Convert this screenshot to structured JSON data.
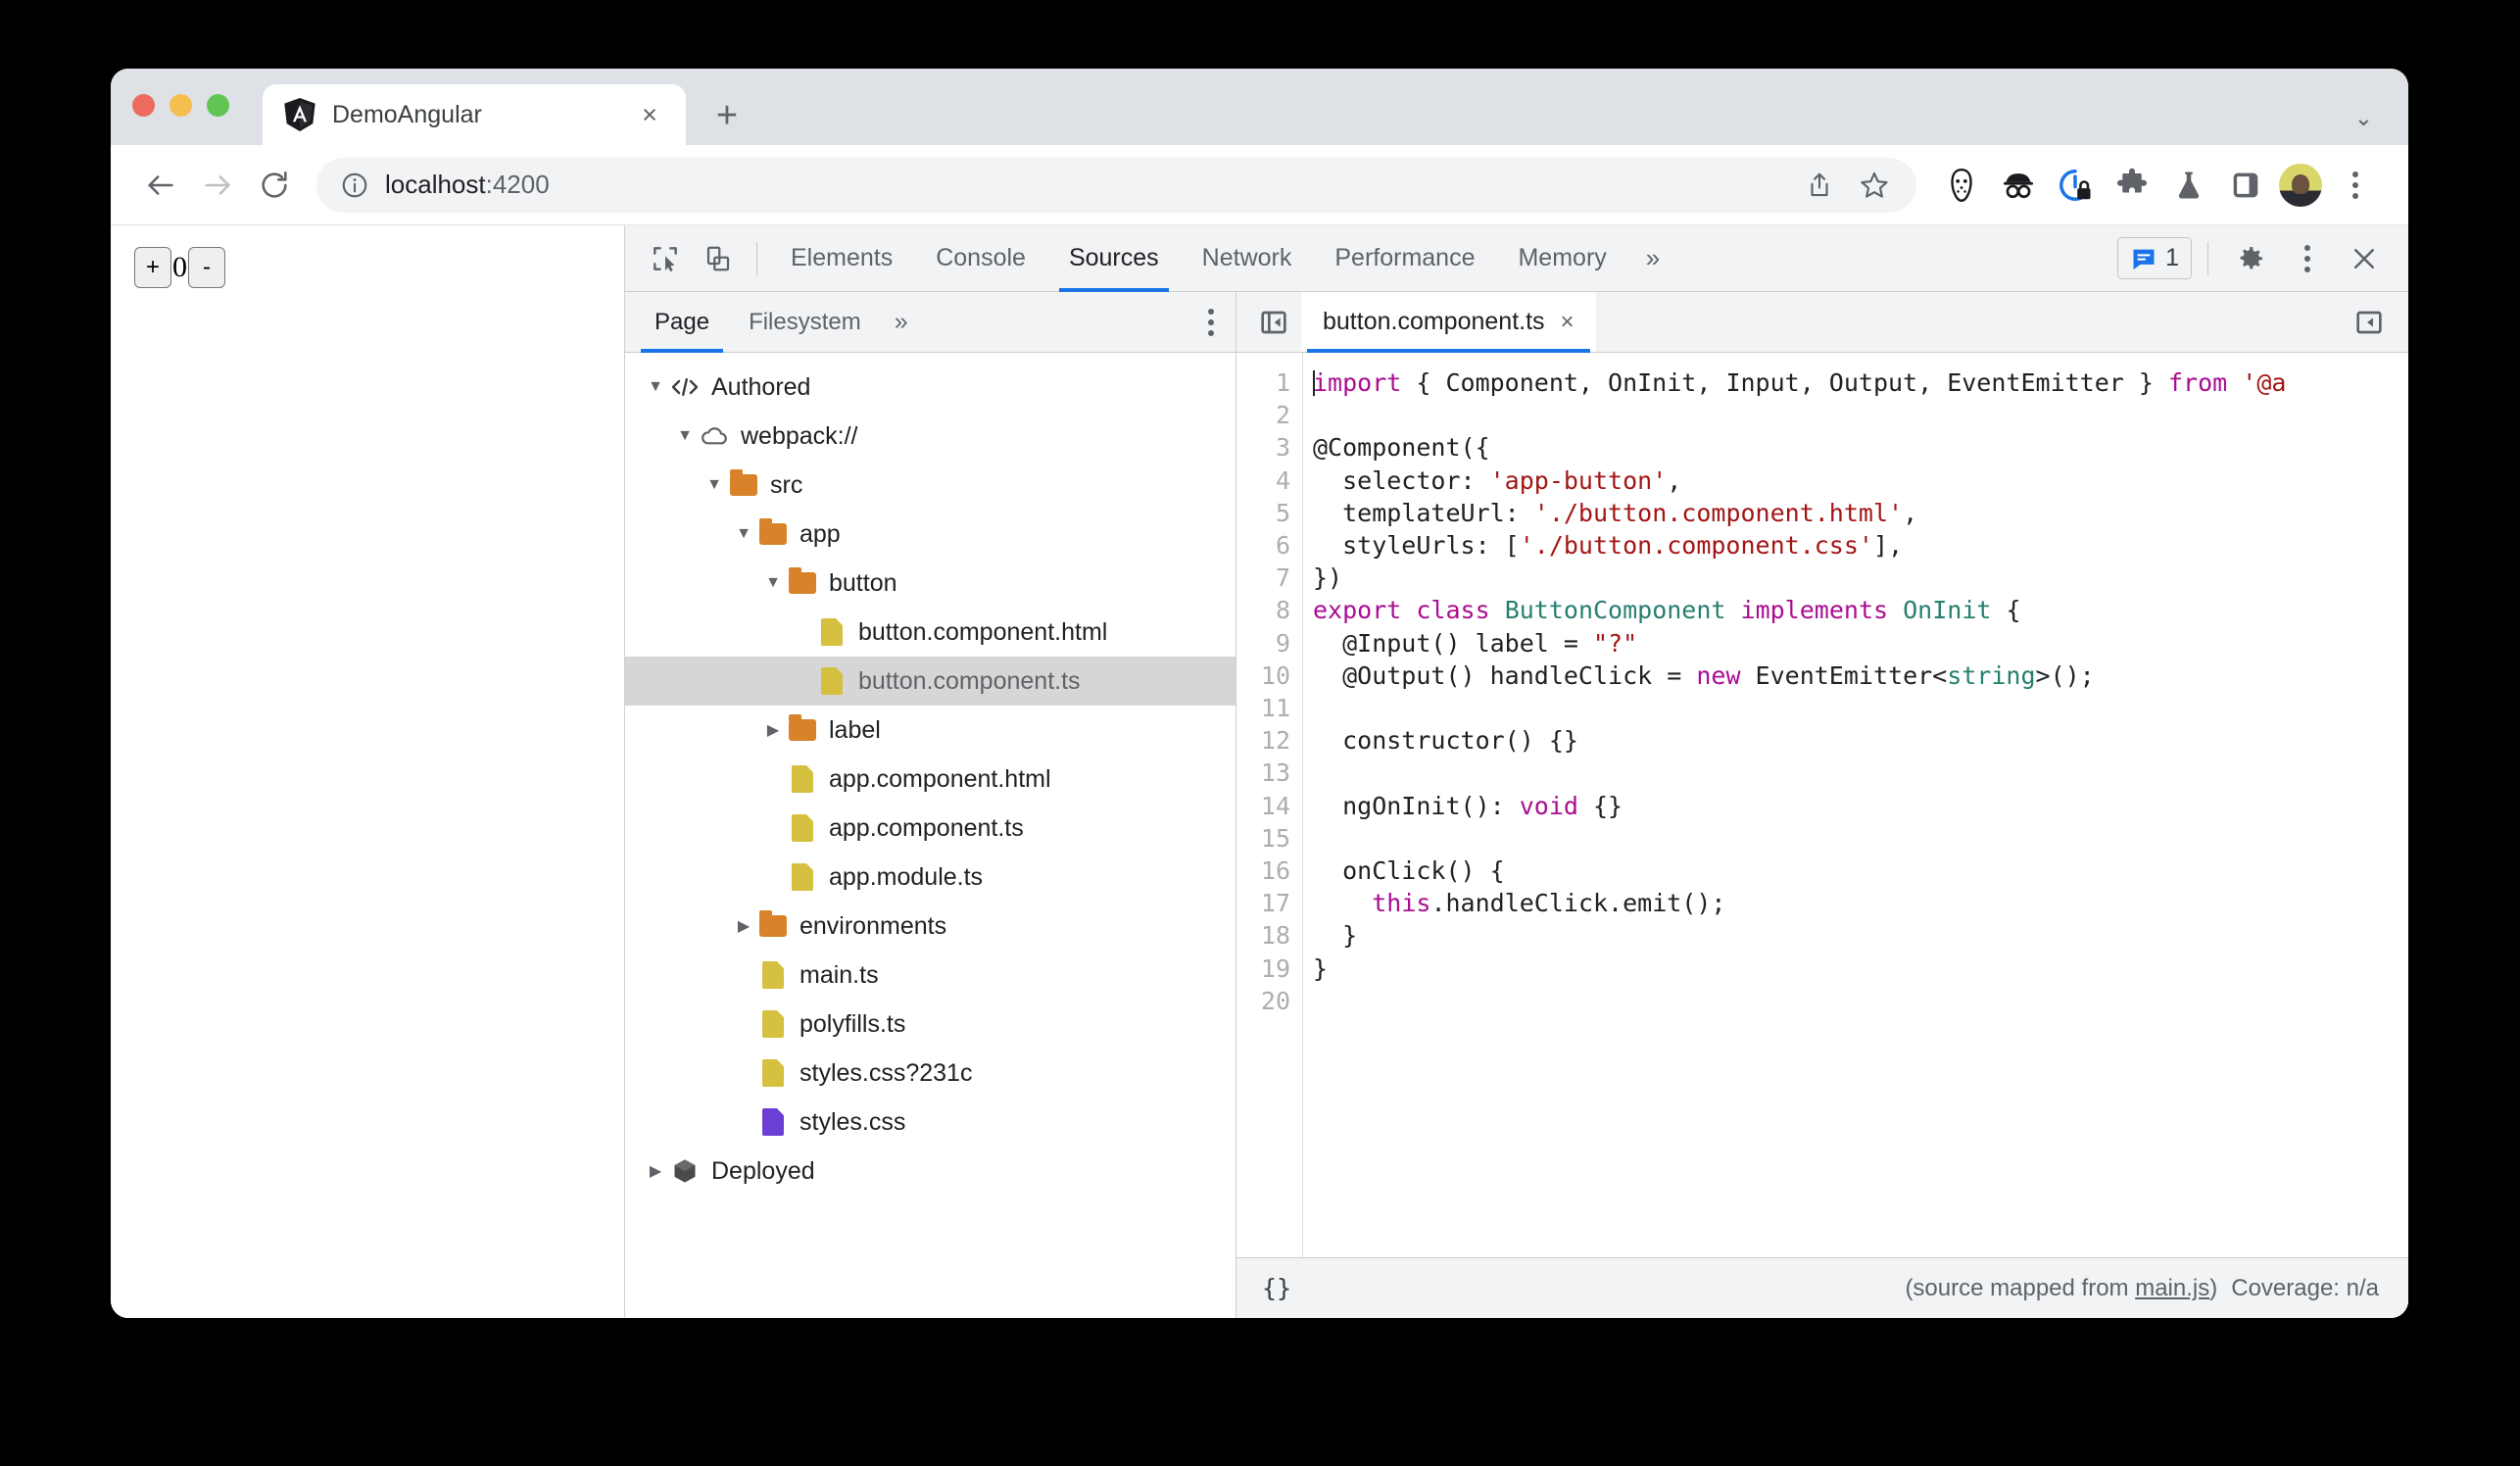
{
  "browser": {
    "tab": {
      "title": "DemoAngular",
      "favicon": "angular-logo-icon",
      "close": "×"
    },
    "new_tab": "+",
    "tabstrip_menu": "⌄",
    "nav": {
      "back": "←",
      "forward": "→",
      "reload": "⟳"
    },
    "omnibox": {
      "info_icon": "site-info-icon",
      "url_host": "localhost",
      "url_port": ":4200",
      "share_icon": "share-icon",
      "bookmark_icon": "star-icon"
    },
    "extensions": [
      {
        "name": "hockey-mask-extension-icon"
      },
      {
        "name": "incognito-og-extension-icon"
      },
      {
        "name": "privacy-lock-extension-icon"
      },
      {
        "name": "puzzle-extensions-icon"
      },
      {
        "name": "flask-experiments-icon"
      },
      {
        "name": "side-panel-icon"
      }
    ],
    "profile_avatar": "user-avatar",
    "chrome_menu": "three-dot-menu-icon"
  },
  "page": {
    "increment_label": "+",
    "counter_value": "0",
    "decrement_label": "-"
  },
  "devtools": {
    "inspect_icon": "inspect-element-icon",
    "device_icon": "device-toolbar-icon",
    "tabs": [
      {
        "label": "Elements",
        "active": false
      },
      {
        "label": "Console",
        "active": false
      },
      {
        "label": "Sources",
        "active": true
      },
      {
        "label": "Network",
        "active": false
      },
      {
        "label": "Performance",
        "active": false
      },
      {
        "label": "Memory",
        "active": false
      }
    ],
    "more_tabs": "»",
    "issues": {
      "icon": "message-issues-icon",
      "count": "1"
    },
    "settings_icon": "gear-icon",
    "kebab_icon": "three-dot-menu-icon",
    "close_icon": "close-icon",
    "accent_color": "#1a73e8"
  },
  "navigator": {
    "tabs": [
      {
        "label": "Page",
        "active": true
      },
      {
        "label": "Filesystem",
        "active": false
      }
    ],
    "more": "»",
    "kebab_icon": "three-dot-menu-icon",
    "tree": [
      {
        "label": "Authored",
        "icon": "code-brackets-icon",
        "indent": 0,
        "caret": "down"
      },
      {
        "label": "webpack://",
        "icon": "cloud-icon",
        "indent": 1,
        "caret": "down"
      },
      {
        "label": "src",
        "icon": "folder-icon",
        "indent": 2,
        "caret": "down"
      },
      {
        "label": "app",
        "icon": "folder-icon",
        "indent": 3,
        "caret": "down"
      },
      {
        "label": "button",
        "icon": "folder-icon",
        "indent": 4,
        "caret": "down"
      },
      {
        "label": "button.component.html",
        "icon": "file-icon",
        "indent": 5,
        "caret": "none"
      },
      {
        "label": "button.component.ts",
        "icon": "file-icon",
        "indent": 5,
        "caret": "none",
        "selected": true
      },
      {
        "label": "label",
        "icon": "folder-icon",
        "indent": 4,
        "caret": "right"
      },
      {
        "label": "app.component.html",
        "icon": "file-icon",
        "indent": 4,
        "caret": "none"
      },
      {
        "label": "app.component.ts",
        "icon": "file-icon",
        "indent": 4,
        "caret": "none"
      },
      {
        "label": "app.module.ts",
        "icon": "file-icon",
        "indent": 4,
        "caret": "none"
      },
      {
        "label": "environments",
        "icon": "folder-icon",
        "indent": 3,
        "caret": "right"
      },
      {
        "label": "main.ts",
        "icon": "file-icon",
        "indent": 3,
        "caret": "none"
      },
      {
        "label": "polyfills.ts",
        "icon": "file-icon",
        "indent": 3,
        "caret": "none"
      },
      {
        "label": "styles.css?231c",
        "icon": "file-icon",
        "indent": 3,
        "caret": "none"
      },
      {
        "label": "styles.css",
        "icon": "file-icon-purple",
        "indent": 3,
        "caret": "none"
      },
      {
        "label": "Deployed",
        "icon": "cube-icon",
        "indent": 0,
        "caret": "right"
      }
    ]
  },
  "editor": {
    "collapse_navigator_icon": "collapse-left-panel-icon",
    "open_debugger_icon": "open-right-panel-icon",
    "file_tab": {
      "name": "button.component.ts",
      "close": "×"
    },
    "line_numbers": [
      "1",
      "2",
      "3",
      "4",
      "5",
      "6",
      "7",
      "8",
      "9",
      "10",
      "11",
      "12",
      "13",
      "14",
      "15",
      "16",
      "17",
      "18",
      "19",
      "20"
    ],
    "code_lines": [
      [
        {
          "t": "import",
          "c": "kw"
        },
        {
          "t": " { Component, OnInit, Input, Output, EventEmitter } ",
          "c": ""
        },
        {
          "t": "from",
          "c": "kw"
        },
        {
          "t": " ",
          "c": ""
        },
        {
          "t": "'@a",
          "c": "str"
        }
      ],
      [],
      [
        {
          "t": "@Component({",
          "c": ""
        }
      ],
      [
        {
          "t": "  selector: ",
          "c": ""
        },
        {
          "t": "'app-button'",
          "c": "str"
        },
        {
          "t": ",",
          "c": ""
        }
      ],
      [
        {
          "t": "  templateUrl: ",
          "c": ""
        },
        {
          "t": "'./button.component.html'",
          "c": "str"
        },
        {
          "t": ",",
          "c": ""
        }
      ],
      [
        {
          "t": "  styleUrls: [",
          "c": ""
        },
        {
          "t": "'./button.component.css'",
          "c": "str"
        },
        {
          "t": "],",
          "c": ""
        }
      ],
      [
        {
          "t": "})",
          "c": ""
        }
      ],
      [
        {
          "t": "export class",
          "c": "kw"
        },
        {
          "t": " ",
          "c": ""
        },
        {
          "t": "ButtonComponent",
          "c": "typ"
        },
        {
          "t": " ",
          "c": ""
        },
        {
          "t": "implements",
          "c": "kw"
        },
        {
          "t": " ",
          "c": ""
        },
        {
          "t": "OnInit",
          "c": "typ"
        },
        {
          "t": " {",
          "c": ""
        }
      ],
      [
        {
          "t": "  @Input() label = ",
          "c": ""
        },
        {
          "t": "\"?\"",
          "c": "str"
        }
      ],
      [
        {
          "t": "  @Output() handleClick = ",
          "c": ""
        },
        {
          "t": "new",
          "c": "kw"
        },
        {
          "t": " EventEmitter<",
          "c": ""
        },
        {
          "t": "string",
          "c": "typ"
        },
        {
          "t": ">();",
          "c": ""
        }
      ],
      [],
      [
        {
          "t": "  constructor() {}",
          "c": ""
        }
      ],
      [],
      [
        {
          "t": "  ngOnInit(): ",
          "c": ""
        },
        {
          "t": "void",
          "c": "kw"
        },
        {
          "t": " {}",
          "c": ""
        }
      ],
      [],
      [
        {
          "t": "  onClick() {",
          "c": ""
        }
      ],
      [
        {
          "t": "    ",
          "c": ""
        },
        {
          "t": "this",
          "c": "kw"
        },
        {
          "t": ".handleClick.emit();",
          "c": ""
        }
      ],
      [
        {
          "t": "  }",
          "c": ""
        }
      ],
      [
        {
          "t": "}",
          "c": ""
        }
      ],
      []
    ],
    "status": {
      "pretty_print": "{}",
      "source_mapped_prefix": "(source mapped from ",
      "source_mapped_link": "main.js",
      "source_mapped_suffix": ")",
      "coverage": "Coverage: n/a"
    }
  }
}
